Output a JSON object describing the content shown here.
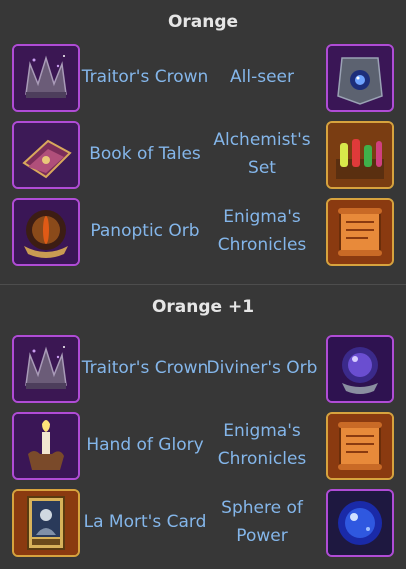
{
  "sections": [
    {
      "title": "Orange",
      "rows": [
        {
          "left": {
            "name": "Traitor's Crown",
            "icon": "traitors-crown-icon",
            "frame": "#b04cd6"
          },
          "right": {
            "name": "All-seer",
            "icon": "all-seer-icon",
            "frame": "#b04cd6"
          }
        },
        {
          "left": {
            "name": "Book of Tales",
            "icon": "book-of-tales-icon",
            "frame": "#b04cd6"
          },
          "right": {
            "name": "Alchemist's Set",
            "icon": "alchemists-set-icon",
            "frame": "#d7a33e"
          }
        },
        {
          "left": {
            "name": "Panoptic Orb",
            "icon": "panoptic-orb-icon",
            "frame": "#b04cd6"
          },
          "right": {
            "name": "Enigma's Chronicles",
            "icon": "enigmas-chronicles-icon",
            "frame": "#d7a33e"
          }
        }
      ]
    },
    {
      "title": "Orange +1",
      "rows": [
        {
          "left": {
            "name": "Traitor's Crown",
            "icon": "traitors-crown-icon",
            "frame": "#b04cd6"
          },
          "right": {
            "name": "Diviner's Orb",
            "icon": "diviners-orb-icon",
            "frame": "#b04cd6"
          }
        },
        {
          "left": {
            "name": "Hand of Glory",
            "icon": "hand-of-glory-icon",
            "frame": "#b04cd6"
          },
          "right": {
            "name": "Enigma's Chronicles",
            "icon": "enigmas-chronicles-icon",
            "frame": "#d7a33e"
          }
        },
        {
          "left": {
            "name": "La Mort's Card",
            "icon": "la-morts-card-icon",
            "frame": "#d7a33e"
          },
          "right": {
            "name": "Sphere of Power",
            "icon": "sphere-of-power-icon",
            "frame": "#b04cd6"
          }
        }
      ]
    }
  ],
  "colors": {
    "background": "#373737",
    "title": "#e6e6e6",
    "item_label": "#84b6ea",
    "purple_frame": "#b04cd6",
    "gold_frame": "#d7a33e"
  }
}
